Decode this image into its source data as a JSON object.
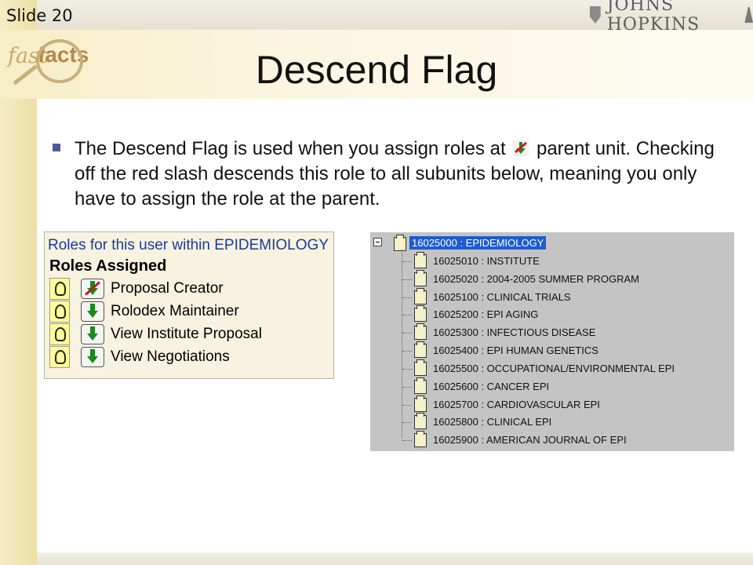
{
  "slide": {
    "number_label": "Slide 20",
    "logo_text": "JOHNS HOPKINS",
    "brand_fast": "fast",
    "brand_facts": "facts",
    "title": "Descend Flag",
    "body_part1": "The Descend Flag is used when you assign roles at",
    "body_part2": "parent unit. Checking off the red slash descends this role to all subunits below, meaning you only have to assign the role at the parent."
  },
  "roles_panel": {
    "header": "Roles for this user within EPIDEMIOLOGY",
    "subheader": "Roles Assigned",
    "roles": [
      {
        "label": "Proposal Creator",
        "descend": false
      },
      {
        "label": "Rolodex Maintainer",
        "descend": true
      },
      {
        "label": "View Institute Proposal",
        "descend": true
      },
      {
        "label": "View Negotiations",
        "descend": true
      }
    ]
  },
  "tree_panel": {
    "root": "16025000 : EPIDEMIOLOGY",
    "children": [
      "16025010 : INSTITUTE",
      "16025020 : 2004-2005 SUMMER PROGRAM",
      "16025100 : CLINICAL TRIALS",
      "16025200 : EPI AGING",
      "16025300 : INFECTIOUS DISEASE",
      "16025400 : EPI HUMAN GENETICS",
      "16025500 : OCCUPATIONAL/ENVIRONMENTAL EPI",
      "16025600 : CANCER EPI",
      "16025700 : CARDIOVASCULAR EPI",
      "16025800 : CLINICAL EPI",
      "16025900 : AMERICAN JOURNAL OF EPI"
    ]
  },
  "colors": {
    "tree_selection": "#1e5bd0",
    "roles_header": "#1c3a9c",
    "arrow_green": "#1a8a1a",
    "slash_red": "#d01818"
  }
}
